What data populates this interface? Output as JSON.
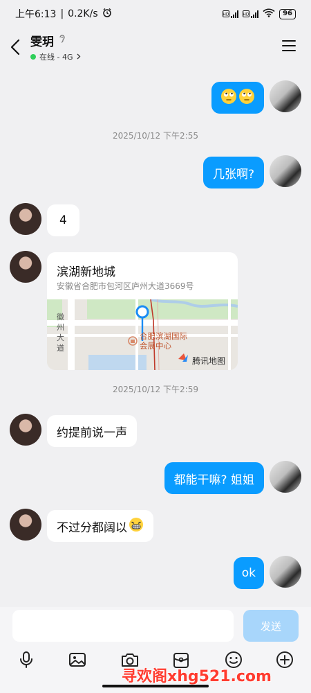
{
  "status_bar": {
    "time": "上午6:13",
    "speed": "0.2K/s",
    "battery": "96"
  },
  "header": {
    "contact_name": "雯玥",
    "status_text": "在线 - 4G",
    "status_color": "#2fcf5a"
  },
  "messages": [
    {
      "direction": "out",
      "type": "emoji",
      "text": "",
      "icon": "rolling-eyes-emoji"
    },
    {
      "direction": "timestamp",
      "text": "2025/10/12 下午2:55"
    },
    {
      "direction": "out",
      "type": "text",
      "text": "几张啊?"
    },
    {
      "direction": "in",
      "type": "text",
      "text": "4"
    },
    {
      "direction": "in",
      "type": "location",
      "title": "滨湖新地城",
      "address": "安徽省合肥市包河区庐州大道3669号",
      "map": {
        "road_label": "徽州大道",
        "poi_label_line1": "合肥滨湖国际",
        "poi_label_line2": "会展中心",
        "provider": "腾讯地图"
      }
    },
    {
      "direction": "timestamp",
      "text": "2025/10/12 下午2:59"
    },
    {
      "direction": "in",
      "type": "text",
      "text": "约提前说一声"
    },
    {
      "direction": "out",
      "type": "text",
      "text": "都能干嘛? 姐姐"
    },
    {
      "direction": "in",
      "type": "text",
      "text": "不过分都阔以",
      "trailing_icon": "grinning-emoji"
    },
    {
      "direction": "out",
      "type": "text",
      "text": "ok"
    }
  ],
  "composer": {
    "input_value": "",
    "input_placeholder": "",
    "send_label": "发送"
  },
  "toolbar": [
    "voice-icon",
    "image-icon",
    "camera-icon",
    "red-packet-icon",
    "emoji-icon",
    "plus-icon"
  ],
  "watermark": "寻欢阁xhg521.com",
  "colors": {
    "accent": "#0a9cff",
    "send_disabled": "#a8d6fb",
    "background": "#f0f0f2"
  }
}
